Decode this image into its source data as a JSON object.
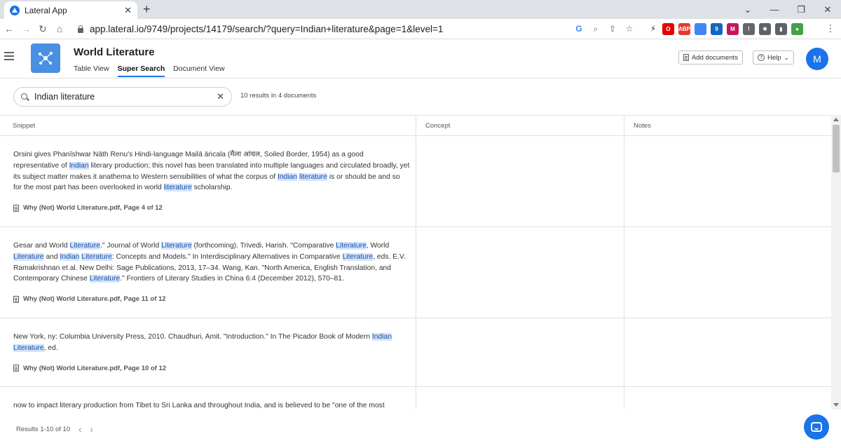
{
  "browser": {
    "tab_title": "Lateral App",
    "url": "app.lateral.io/9749/projects/14179/search/?query=Indian+literature&page=1&level=1",
    "extensions": [
      {
        "name": "opera",
        "color": "#e60000",
        "text": "O"
      },
      {
        "name": "abp",
        "color": "#e53935",
        "text": "ABP"
      },
      {
        "name": "doc",
        "color": "#4285f4",
        "text": ""
      },
      {
        "name": "ext-blue",
        "color": "#1565c0",
        "text": "9"
      },
      {
        "name": "books",
        "color": "#c2185b",
        "text": "M"
      },
      {
        "name": "save",
        "color": "#666666",
        "text": "!"
      },
      {
        "name": "puzzle",
        "color": "#5f6368",
        "text": "✱"
      },
      {
        "name": "sidebar",
        "color": "#5f6368",
        "text": "▮"
      },
      {
        "name": "profile",
        "color": "#43a047",
        "text": "●"
      }
    ]
  },
  "header": {
    "project_title": "World Literature",
    "tabs": [
      "Table View",
      "Super Search",
      "Document View"
    ],
    "active_tab": "Super Search",
    "add_documents_label": "Add documents",
    "help_label": "Help",
    "avatar_initial": "M"
  },
  "search": {
    "query": "Indian literature",
    "results_summary": "10 results in 4 documents"
  },
  "table": {
    "columns": [
      "Snippet",
      "Concept",
      "Notes"
    ],
    "rows": [
      {
        "segments": [
          {
            "t": "Orsini gives Phanīshwar Nāth Renu's Hindi-language Mailā āṅcala (मैला आंचल, Soiled Border, 1954) as a good representative of "
          },
          {
            "t": "Indian",
            "h": true
          },
          {
            "t": " literary production; this novel has been translated into multiple languages and circulated broadly, yet its subject matter makes it anathema to Western sensibilities of what the corpus of "
          },
          {
            "t": "Indian",
            "h": true
          },
          {
            "t": " "
          },
          {
            "t": "literature",
            "h": true
          },
          {
            "t": " is or should be and so for the most part has been overlooked in world "
          },
          {
            "t": "literature",
            "h": true
          },
          {
            "t": " scholarship."
          }
        ],
        "source": "Why (Not) World Literature.pdf, Page 4 of 12",
        "height": 130
      },
      {
        "segments": [
          {
            "t": "Gesar and World "
          },
          {
            "t": "Literature",
            "h": true
          },
          {
            "t": ".\" Journal of World "
          },
          {
            "t": "Literature",
            "h": true
          },
          {
            "t": " (forthcoming). Trivedi, Harish. \"Comparative "
          },
          {
            "t": "Literature",
            "h": true
          },
          {
            "t": ", World "
          },
          {
            "t": "Literature",
            "h": true
          },
          {
            "t": " and "
          },
          {
            "t": "Indian",
            "h": true
          },
          {
            "t": " "
          },
          {
            "t": "Literature",
            "h": true
          },
          {
            "t": ": Concepts and Models.\" In Interdisciplinary Alternatives in Comparative "
          },
          {
            "t": "Literature",
            "h": true
          },
          {
            "t": ", eds. E.V. Ramakrishnan et al. New Delhi: Sage Publications, 2013, 17–34. Wang, Kan. \"North America, English Translation, and Contemporary Chinese "
          },
          {
            "t": "Literature",
            "h": true
          },
          {
            "t": ".\" Frontiers of Literary Studies in China 6:4 (December 2012), 570–81."
          }
        ],
        "source": "Why (Not) World Literature.pdf, Page 11 of 12",
        "height": 130
      },
      {
        "segments": [
          {
            "t": "New York, ny: Columbia University Press, 2010. Chaudhuri, Amit. \"Introduction.\" In The Picador Book of Modern "
          },
          {
            "t": "Indian",
            "h": true
          },
          {
            "t": " "
          },
          {
            "t": "Literature",
            "h": true
          },
          {
            "t": ", ed."
          }
        ],
        "source": "Why (Not) World Literature.pdf, Page 10 of 12",
        "height": 98
      },
      {
        "segments": [
          {
            "t": "now to impact literary production from Tibet to Sri Lanka and throughout India, and is believed to be \"one of the most"
          }
        ],
        "source": "",
        "height": 60
      }
    ]
  },
  "pagination": {
    "label": "Results 1-10 of 10"
  }
}
